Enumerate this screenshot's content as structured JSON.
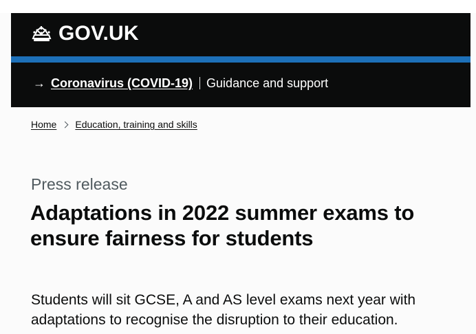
{
  "header": {
    "logo_text": "GOV.UK"
  },
  "banner": {
    "link_text": "Coronavirus (COVID-19)",
    "text": "Guidance and support"
  },
  "breadcrumb": [
    {
      "label": "Home"
    },
    {
      "label": "Education, training and skills"
    }
  ],
  "main": {
    "caption": "Press release",
    "title": "Adaptations in 2022 summer exams to ensure fairness for students",
    "lead": "Students will sit GCSE, A and AS level exams next year with adaptations to recognise the disruption to their education."
  },
  "icons": {
    "logo": "crown-icon",
    "banner_arrow": "arrow-right-icon",
    "breadcrumb_separator": "chevron-right-icon"
  },
  "colors": {
    "header_background": "#0b0c0c",
    "accent_blue": "#1d70b8",
    "text": "#0b0c0c",
    "secondary_text": "#505a5f"
  }
}
